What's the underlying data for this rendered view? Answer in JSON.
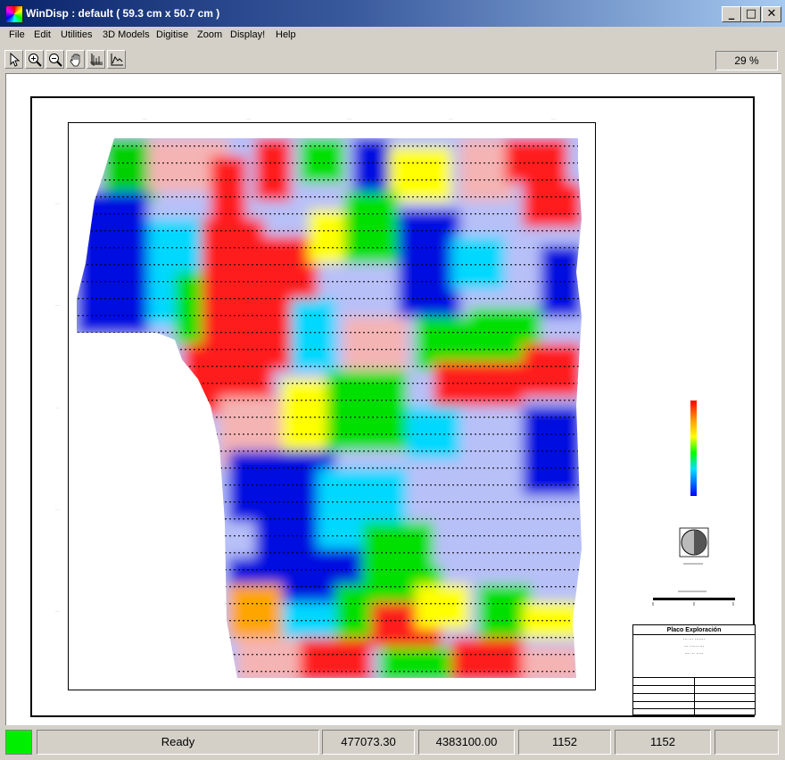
{
  "window": {
    "title": "WinDisp : default ( 59.3 cm x 50.7 cm )",
    "min_glyph": "_",
    "max_glyph": "□",
    "close_glyph": "✕"
  },
  "menu": [
    "File",
    "Edit",
    "Utilities",
    "3D Models",
    "Digitise",
    "Zoom",
    "Display!",
    "Help"
  ],
  "toolbar": {
    "tools": [
      "pointer-icon",
      "zoom-in-icon",
      "zoom-out-icon",
      "pan-hand-icon",
      "axes-icon",
      "profile-graph-icon"
    ],
    "zoom_level": "29 %"
  },
  "map": {
    "x_ticks": [
      "·····",
      "·····",
      "·····",
      "·····",
      "·····"
    ],
    "y_ticks": [
      "·····",
      "·····",
      "·····",
      "·····",
      "·····"
    ],
    "title_block": {
      "company": "Placo Exploración",
      "line2": "··· ··· ·······",
      "line3": "··· ······ ···",
      "line4": "···· ·· ·····"
    },
    "palette": {
      "red": "#ff1a1a",
      "orange": "#ffa500",
      "yellow": "#ffff00",
      "green": "#00e000",
      "cyan": "#00d8ff",
      "blue": "#0010e0",
      "pink": "#f4b4b4",
      "lavender": "#b8c0f8"
    }
  },
  "status": {
    "message": "Ready",
    "easting": "477073.30",
    "northing": "4383100.00",
    "col": "1152",
    "row": "1152",
    "indicator_color": "#00ee00"
  }
}
